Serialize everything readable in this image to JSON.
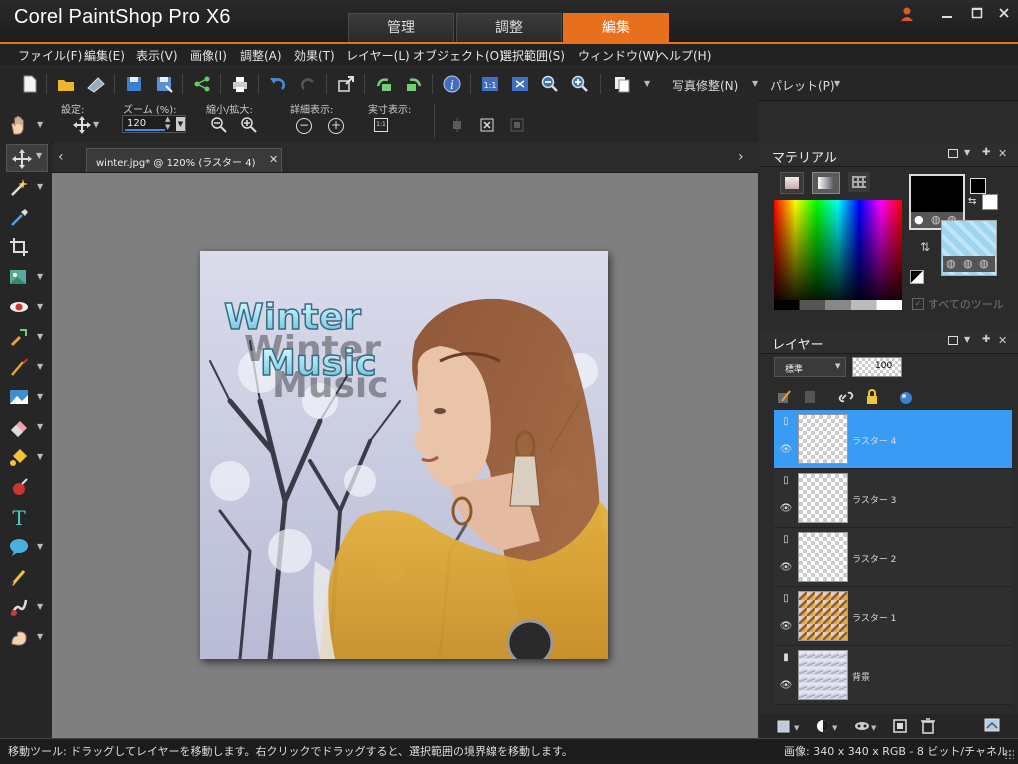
{
  "app": {
    "title": "Corel PaintShop Pro X6"
  },
  "workspace_tabs": [
    {
      "label": "管理"
    },
    {
      "label": "調整"
    },
    {
      "label": "編集"
    }
  ],
  "menu": [
    "ファイル(F)",
    "編集(E)",
    "表示(V)",
    "画像(I)",
    "調整(A)",
    "効果(T)",
    "レイヤー(L)",
    "オブジェクト(O)",
    "選択範囲(S)",
    "ウィンドウ(W)",
    "ヘルプ(H)"
  ],
  "toolbar": {
    "photo_fix_label": "写真修整(N)",
    "palette_label": "パレット(P)"
  },
  "tool_options": {
    "settings_label": "設定:",
    "zoom_label": "ズーム (%):",
    "zoom_value": "120",
    "zoom_inout_label": "縮小/拡大:",
    "detail_label": "詳細表示:",
    "actual_label": "実寸表示:",
    "actual_icon_text": "1:1"
  },
  "document": {
    "tab_label": "winter.jpg* @ 120% (ラスター 4)"
  },
  "image_text": {
    "line1": "Winter",
    "line2": "Music"
  },
  "materials": {
    "title": "マテリアル",
    "all_tools_label": "すべてのツール",
    "foreground": "#000000",
    "background": "#ffffff"
  },
  "layers": {
    "title": "レイヤー",
    "blend_mode": "標準",
    "opacity": "100",
    "items": [
      {
        "name": "ラスター 4",
        "selected": true
      },
      {
        "name": "ラスター 3",
        "selected": false
      },
      {
        "name": "ラスター 2",
        "selected": false
      },
      {
        "name": "ラスター 1",
        "selected": false
      },
      {
        "name": "背景",
        "selected": false
      }
    ]
  },
  "status": {
    "message": "移動ツール: ドラッグしてレイヤーを移動します。右クリックでドラッグすると、選択範囲の境界線を移動します。",
    "image_info": "画像: 340 x 340 x RGB - 8 ビット/チャネル"
  }
}
